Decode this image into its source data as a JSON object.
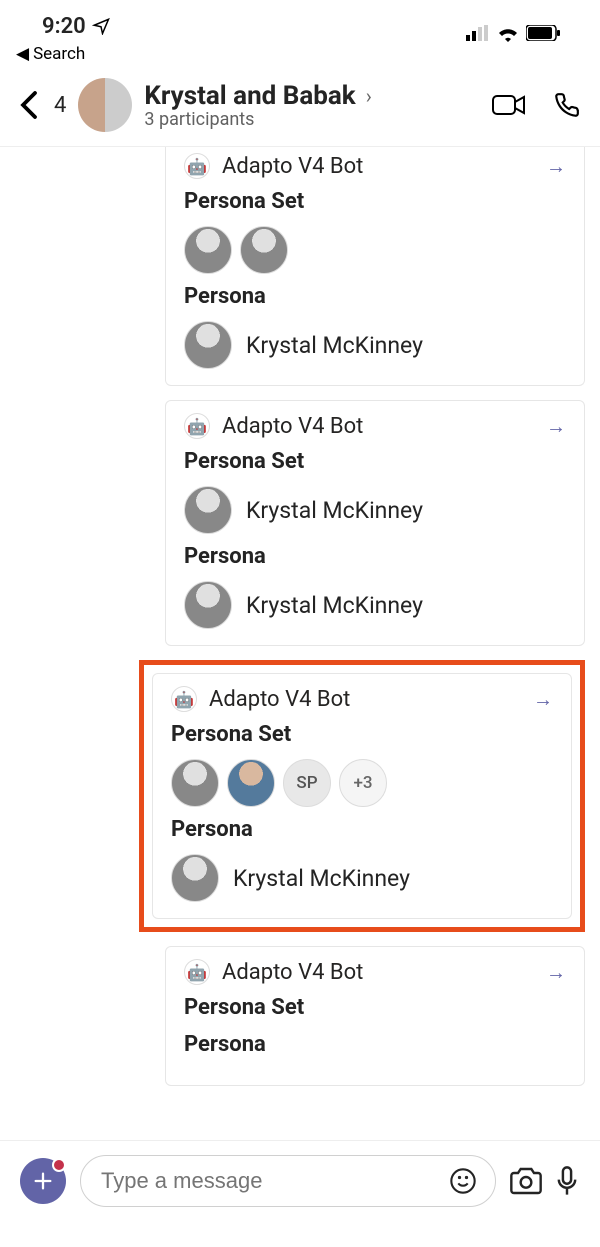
{
  "statusbar": {
    "time": "9:20",
    "back_app_label": "Search"
  },
  "header": {
    "back_count": "4",
    "title": "Krystal and Babak",
    "subtitle": "3 participants"
  },
  "bot_name": "Adapto V4 Bot",
  "section_set": "Persona Set",
  "section_persona": "Persona",
  "persona_name": "Krystal McKinney",
  "extra": {
    "initials": "SP",
    "overflow": "+3"
  },
  "composer": {
    "placeholder": "Type a message"
  }
}
